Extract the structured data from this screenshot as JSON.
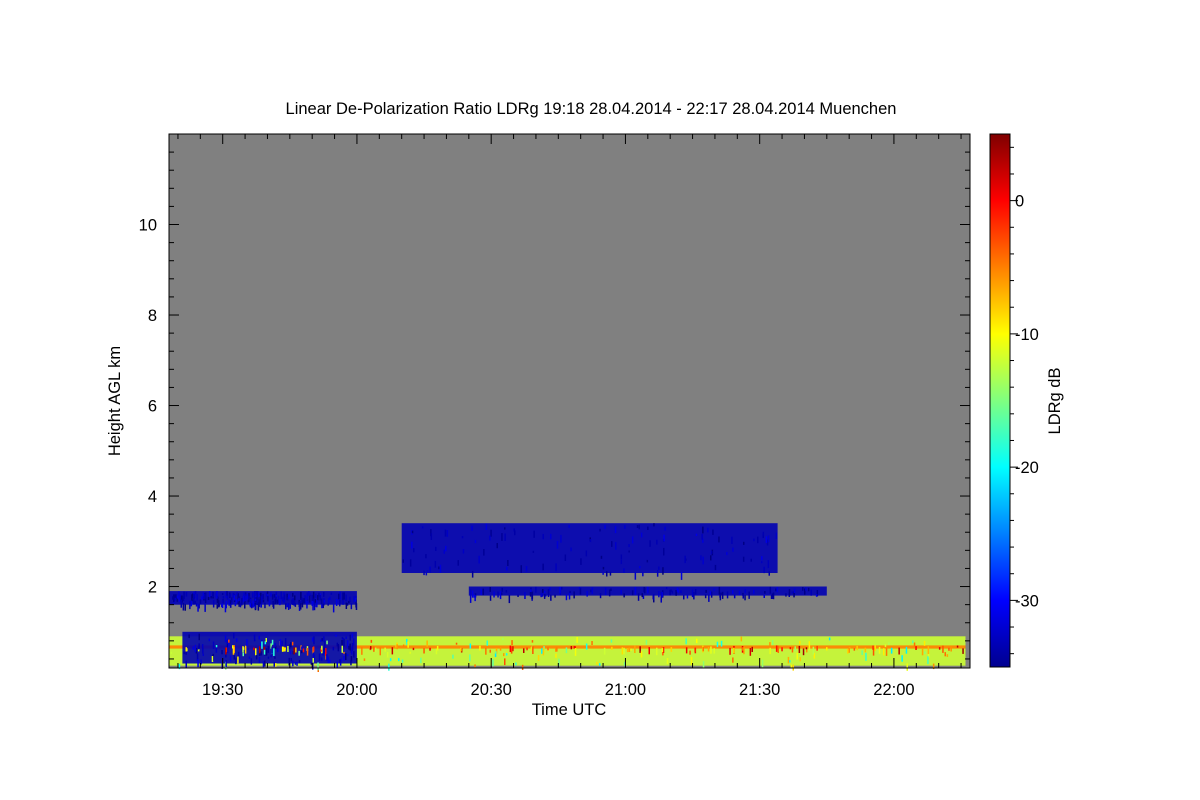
{
  "chart_data": {
    "type": "heatmap",
    "title": "Linear De-Polarization Ratio LDRg   19:18 28.04.2014 - 22:17 28.04.2014 Muenchen",
    "xlabel": "Time UTC",
    "ylabel": "Height AGL km",
    "x_range_minutes_utc": [
      1158,
      1337
    ],
    "y_range_km": [
      0.2,
      12.0
    ],
    "x_ticks": [
      {
        "minute": 1170,
        "label": "19:30"
      },
      {
        "minute": 1200,
        "label": "20:00"
      },
      {
        "minute": 1230,
        "label": "20:30"
      },
      {
        "minute": 1260,
        "label": "21:00"
      },
      {
        "minute": 1290,
        "label": "21:30"
      },
      {
        "minute": 1320,
        "label": "22:00"
      }
    ],
    "y_ticks": [
      {
        "value": 2,
        "label": "2"
      },
      {
        "value": 4,
        "label": "4"
      },
      {
        "value": 6,
        "label": "6"
      },
      {
        "value": 8,
        "label": "8"
      },
      {
        "value": 10,
        "label": "10"
      }
    ],
    "colorbar": {
      "label": "LDRg dB",
      "range": [
        -35,
        5
      ],
      "ticks": [
        {
          "value": 0,
          "label": "0"
        },
        {
          "value": -10,
          "label": "-10"
        },
        {
          "value": -20,
          "label": "-20"
        },
        {
          "value": -30,
          "label": "-30"
        }
      ],
      "colormap": "jet"
    },
    "background_color": "#808080",
    "features": [
      {
        "desc": "depolarizing layer",
        "t_start": 1158,
        "t_end": 1336,
        "h_bottom": 0.25,
        "h_top": 0.9,
        "ldr_db": -12
      },
      {
        "desc": "thin layer",
        "t_start": 1158,
        "t_end": 1336,
        "h_bottom": 0.63,
        "h_top": 0.7,
        "ldr_db": -5
      },
      {
        "desc": "low-depolarization layer",
        "t_start": 1158,
        "t_end": 1178,
        "h_bottom": 1.6,
        "h_top": 1.9,
        "ldr_db": -33
      },
      {
        "desc": "low-depolarization layer",
        "t_start": 1161,
        "t_end": 1200,
        "h_bottom": 0.3,
        "h_top": 1.0,
        "ldr_db": -33
      },
      {
        "desc": "low-depolarization layer",
        "t_start": 1177,
        "t_end": 1200,
        "h_bottom": 1.6,
        "h_top": 1.9,
        "ldr_db": -33
      },
      {
        "desc": "low-depolarization cloud",
        "t_start": 1210,
        "t_end": 1294,
        "h_bottom": 2.3,
        "h_top": 3.4,
        "ldr_db": -33
      },
      {
        "desc": "low-depolarization layer",
        "t_start": 1225,
        "t_end": 1305,
        "h_bottom": 1.8,
        "h_top": 2.0,
        "ldr_db": -33
      }
    ]
  }
}
